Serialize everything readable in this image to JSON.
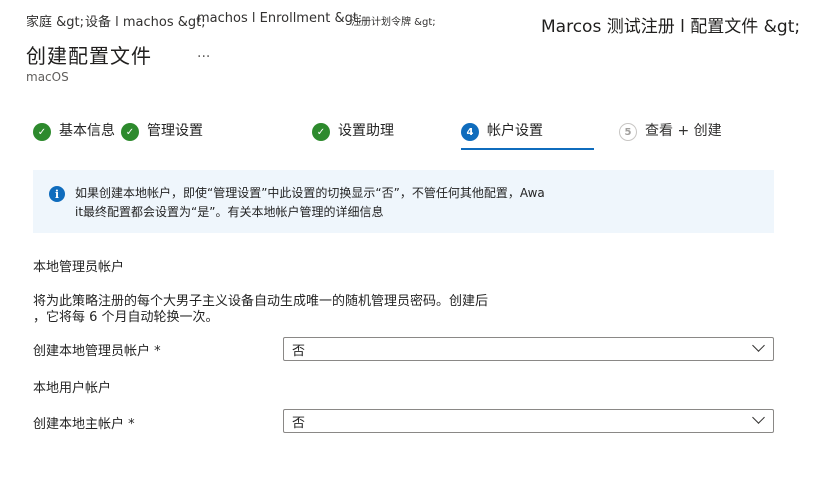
{
  "breadcrumb": {
    "home": "家庭 &gt;",
    "devices": "设备 l machos &gt;",
    "enrollment": "machos l Enrollment &gt;",
    "plan": "注册计划令牌 &gt;"
  },
  "window_title": "Marcos 测试注册 l 配置文件 &gt;",
  "page": {
    "title": "创建配置文件",
    "ellipsis": "...",
    "subtitle": "macOS"
  },
  "wizard": {
    "steps": [
      {
        "label": "基本信息",
        "status": "done"
      },
      {
        "label": "管理设置",
        "status": "done"
      },
      {
        "label": "设置助理",
        "status": "done"
      },
      {
        "number": "4",
        "label": "帐户设置",
        "status": "current"
      },
      {
        "number": "5",
        "label": "查看 + 创建",
        "status": "future"
      }
    ]
  },
  "info_banner": {
    "line1": "如果创建本地帐户，即使“管理设置”中此设置的切换显示“否”，不管任何其他配置，Awa",
    "line2": "it最终配置都会设置为“是”。有关本地帐户管理的详细信息"
  },
  "local_admin": {
    "heading": "本地管理员帐户",
    "desc_line1": "将为此策略注册的每个大男子主义设备自动生成唯一的随机管理员密码。创建后",
    "desc_line2": "，它将每 6 个月自动轮换一次。",
    "field_label": "创建本地管理员帐户 *",
    "value": "否"
  },
  "local_user": {
    "heading": "本地用户帐户",
    "field_label": "创建本地主帐户 *",
    "value": "否"
  },
  "colors": {
    "accent": "#0f6cbd",
    "success": "#2d8a2d",
    "info_background": "#eff6fc"
  }
}
